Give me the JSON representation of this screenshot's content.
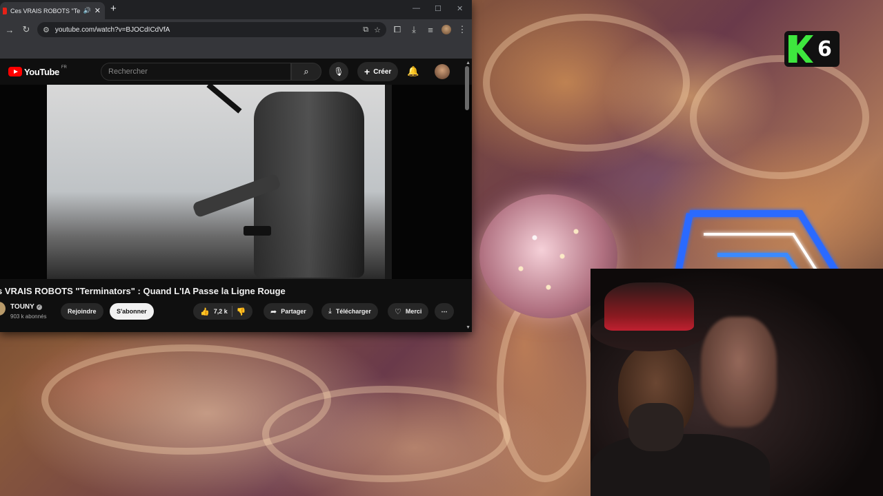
{
  "tab": {
    "title": "Ces VRAIS ROBOTS \"Termin",
    "audio_icon": "speaker-icon",
    "close": "✕",
    "new_tab": "+"
  },
  "window_controls": {
    "minimize": "—",
    "maximize": "☐",
    "close": "✕"
  },
  "address": {
    "url": "youtube.com/watch?v=BJOCdICdVfA"
  },
  "youtube": {
    "logo_text": "YouTube",
    "region": "FR",
    "search_placeholder": "Rechercher",
    "create_label": "Créer",
    "video_title": "s VRAIS ROBOTS \"Terminators\" : Quand L'IA Passe la Ligne Rouge",
    "channel": {
      "name": "TOUNY",
      "subscribers": "903 k abonnés"
    },
    "actions": {
      "join": "Rejoindre",
      "subscribe": "S'abonner",
      "likes": "7,2 k",
      "share": "Partager",
      "download": "Télécharger",
      "thanks": "Merci",
      "more": "⋯"
    }
  },
  "overlay": {
    "k6_number": "6"
  },
  "colors": {
    "youtube_red": "#ff0000",
    "k6_green": "#3ee63e",
    "neon_blue": "#2a6aff",
    "neon_red": "#ff2a4a"
  }
}
